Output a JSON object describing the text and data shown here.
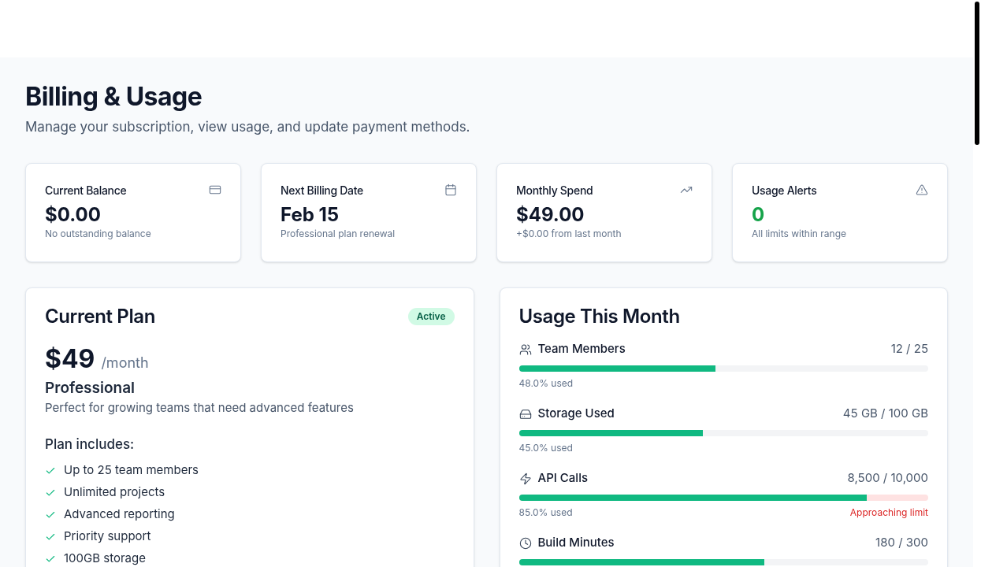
{
  "page": {
    "title": "Billing & Usage",
    "subtitle": "Manage your subscription, view usage, and update payment methods."
  },
  "stats": [
    {
      "label": "Current Balance",
      "value": "$0.00",
      "note": "No outstanding balance",
      "kind": "neutral"
    },
    {
      "label": "Next Billing Date",
      "value": "Feb 15",
      "note": "Professional plan renewal",
      "kind": "neutral"
    },
    {
      "label": "Monthly Spend",
      "value": "$49.00",
      "note": "+$0.00 from last month",
      "kind": "neutral"
    },
    {
      "label": "Usage Alerts",
      "value": "0",
      "note": "All limits within range",
      "kind": "good"
    }
  ],
  "plan": {
    "title": "Current Plan",
    "badge": "Active",
    "price": "$49",
    "period": "/month",
    "name": "Professional",
    "description": "Perfect for growing teams that need advanced features",
    "includes_heading": "Plan includes:",
    "features": [
      "Up to 25 team members",
      "Unlimited projects",
      "Advanced reporting",
      "Priority support",
      "100GB storage"
    ]
  },
  "usage": {
    "title": "Usage This Month",
    "items": [
      {
        "label": "Team Members",
        "reading": "12 / 25",
        "level": 0.48,
        "used": "48.0% used",
        "near_limit": false
      },
      {
        "label": "Storage Used",
        "reading": "45 GB / 100 GB",
        "level": 0.45,
        "used": "45.0% used",
        "near_limit": false
      },
      {
        "label": "API Calls",
        "reading": "8,500 / 10,000",
        "level": 0.85,
        "used": "85.0% used",
        "near_limit": true,
        "warning": "Approaching limit"
      },
      {
        "label": "Build Minutes",
        "reading": "180 / 300",
        "level": 0.6,
        "near_limit": false
      }
    ]
  }
}
